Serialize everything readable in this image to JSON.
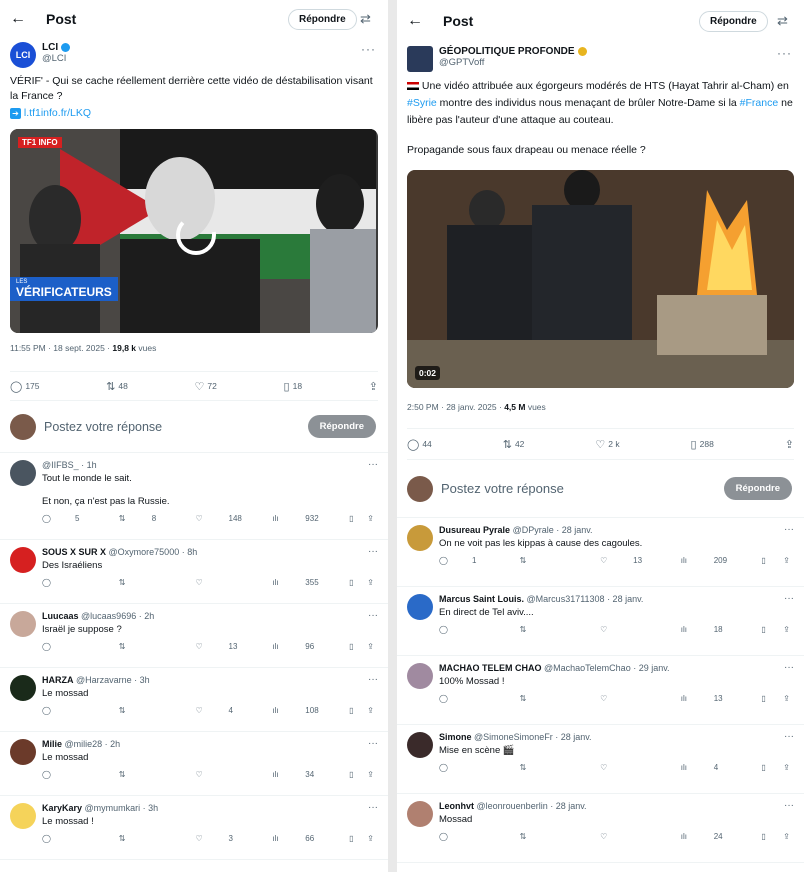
{
  "left": {
    "header": {
      "back": "←",
      "title": "Post",
      "reply_button": "Répondre"
    },
    "author": {
      "name": "LCI",
      "handle": "@LCI"
    },
    "text": "VÉRIF' - Qui se cache réellement derrière cette vidéo de déstabilisation visant la France ?",
    "link": "l.tf1info.fr/LKQ",
    "media": {
      "badge": "TF1 INFO",
      "caption_small": "LES",
      "caption": "VÉRIFICATEURS"
    },
    "meta": {
      "time": "11:55 PM · 18 sept. 2025 · ",
      "views": "19,8 k",
      "views_label": " vues"
    },
    "stats": {
      "replies": "175",
      "reposts": "48",
      "likes": "72",
      "bookmarks": "18"
    },
    "reply_placeholder": "Postez votre réponse",
    "reply_button": "Répondre",
    "replies": [
      {
        "name": "",
        "handle": "@IIFBS_ · 1h",
        "text1": "Tout le monde le sait.",
        "text2": "Et non, ça n'est pas la Russie.",
        "r": "5",
        "rt": "8",
        "l": "148",
        "v": "932",
        "color": "#4a5560"
      },
      {
        "name": "SOUS X SUR X",
        "handle": "@Oxymore75000 · 8h",
        "text1": "Des Israéliens",
        "text2": "",
        "r": "",
        "rt": "",
        "l": "",
        "v": "355",
        "color": "#d62020"
      },
      {
        "name": "Luucaas",
        "handle": "@lucaas9696 · 2h",
        "text1": "Israël je suppose ?",
        "text2": "",
        "r": "",
        "rt": "",
        "l": "13",
        "v": "96",
        "color": "#c8a89a"
      },
      {
        "name": "HARZA",
        "handle": "@Harzavarne · 3h",
        "text1": "Le mossad",
        "text2": "",
        "r": "",
        "rt": "",
        "l": "4",
        "v": "108",
        "color": "#1a2a1a"
      },
      {
        "name": "Milie",
        "handle": "@milie28 · 2h",
        "text1": "Le mossad",
        "text2": "",
        "r": "",
        "rt": "",
        "l": "",
        "v": "34",
        "color": "#6b3a2a"
      },
      {
        "name": "KaryKary",
        "handle": "@mymumkari · 3h",
        "text1": "Le mossad !",
        "text2": "",
        "r": "",
        "rt": "",
        "l": "3",
        "v": "66",
        "color": "#f5d35a"
      }
    ]
  },
  "right": {
    "header": {
      "back": "←",
      "title": "Post",
      "reply_button": "Répondre"
    },
    "author": {
      "name": "GÉOPOLITIQUE PROFONDE",
      "handle": "@GPTVoff"
    },
    "text_pre": " Une vidéo attribuée aux égorgeurs modérés de HTS (Hayat Tahrir al-Cham) en ",
    "tag1": "#Syrie",
    "text_mid": " montre des individus nous menaçant de brûler Notre-Dame si la ",
    "tag2": "#France",
    "text_post": " ne libère pas l'auteur d'une attaque au couteau.",
    "text2": "Propagande sous faux drapeau ou menace réelle ?",
    "media": {
      "duration": "0:02"
    },
    "meta": {
      "time": "2:50 PM · 28 janv. 2025 · ",
      "views": "4,5 M",
      "views_label": " vues"
    },
    "stats": {
      "replies": "44",
      "reposts": "42",
      "likes": "2 k",
      "bookmarks": "288"
    },
    "reply_placeholder": "Postez votre réponse",
    "reply_button": "Répondre",
    "replies": [
      {
        "name": "Dusureau Pyrale",
        "handle": "@DPyrale · 28 janv.",
        "text1": "On ne voit pas les kippas à cause des cagoules.",
        "r": "1",
        "rt": "",
        "l": "13",
        "v": "209",
        "color": "#c89a3a"
      },
      {
        "name": "Marcus Saint Louis.",
        "handle": "@Marcus31711308 · 28 janv.",
        "text1": "En direct de Tel aviv....",
        "r": "",
        "rt": "",
        "l": "",
        "v": "18",
        "color": "#2a6ac8"
      },
      {
        "name": "MACHAO TELEM CHAO",
        "handle": "@MachaoTelemChao · 29 janv.",
        "text1": "100% Mossad !",
        "r": "",
        "rt": "",
        "l": "",
        "v": "13",
        "color": "#a08aa0"
      },
      {
        "name": "Simone",
        "handle": "@SimoneSimoneFr · 28 janv.",
        "text1": "Mise en scène 🎬",
        "r": "",
        "rt": "",
        "l": "",
        "v": "4",
        "color": "#3a2a2a"
      },
      {
        "name": "Leonhvt",
        "handle": "@leonrouenberlin · 28 janv.",
        "text1": "Mossad",
        "r": "",
        "rt": "",
        "l": "",
        "v": "24",
        "color": "#b08070"
      }
    ]
  }
}
